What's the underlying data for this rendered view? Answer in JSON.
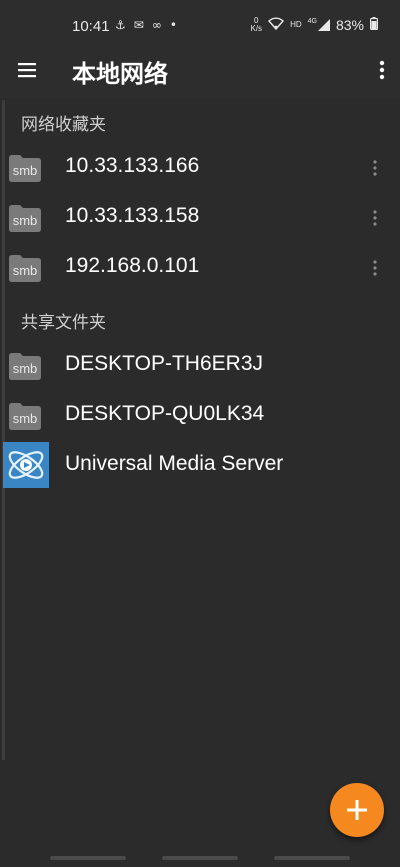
{
  "status_bar": {
    "time": "10:41",
    "net_speed_top": "0",
    "net_speed_unit": "K/s",
    "network_type": "HD",
    "signal_type": "4G",
    "battery_percent": "83%"
  },
  "toolbar": {
    "title": "本地网络"
  },
  "favorites": {
    "header": "网络收藏夹",
    "items": [
      {
        "label": "10.33.133.166",
        "icon_text": "smb",
        "icon": "folder-icon"
      },
      {
        "label": "10.33.133.158",
        "icon_text": "smb",
        "icon": "folder-icon"
      },
      {
        "label": "192.168.0.101",
        "icon_text": "smb",
        "icon": "folder-icon"
      }
    ]
  },
  "shared": {
    "header": "共享文件夹",
    "items": [
      {
        "label": "DESKTOP-TH6ER3J",
        "icon_text": "smb",
        "icon": "folder-icon"
      },
      {
        "label": "DESKTOP-QU0LK34",
        "icon_text": "smb",
        "icon": "folder-icon"
      },
      {
        "label": "Universal Media Server",
        "icon": "media-server-icon"
      }
    ]
  },
  "colors": {
    "background": "#2b2b2b",
    "fab": "#f5881f",
    "folder": "#7a7a7a"
  }
}
